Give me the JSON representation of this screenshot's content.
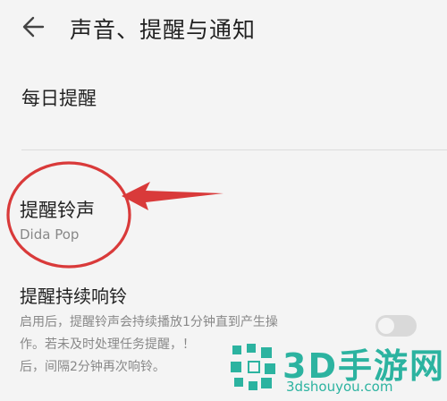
{
  "header": {
    "back_icon": "arrow-left-icon",
    "title": "声音、提醒与通知"
  },
  "settings": {
    "daily_reminder": {
      "label": "每日提醒"
    },
    "ringtone": {
      "label": "提醒铃声",
      "value": "Dida Pop"
    },
    "persistent_ring": {
      "label": "提醒持续响铃",
      "description_lines": [
        "启用后，提醒铃声会持续播放1分钟直到产生操",
        "作。若未及时处理任务提醒，！",
        "后，间隔2分钟再次响铃。"
      ],
      "enabled": false
    }
  },
  "annotation": {
    "color": "#d93a3a",
    "shapes": [
      "circle",
      "arrow"
    ]
  },
  "watermark": {
    "brand": "3D手游网",
    "domain": "3dshouyou.com",
    "color": "#2cb3a0"
  }
}
